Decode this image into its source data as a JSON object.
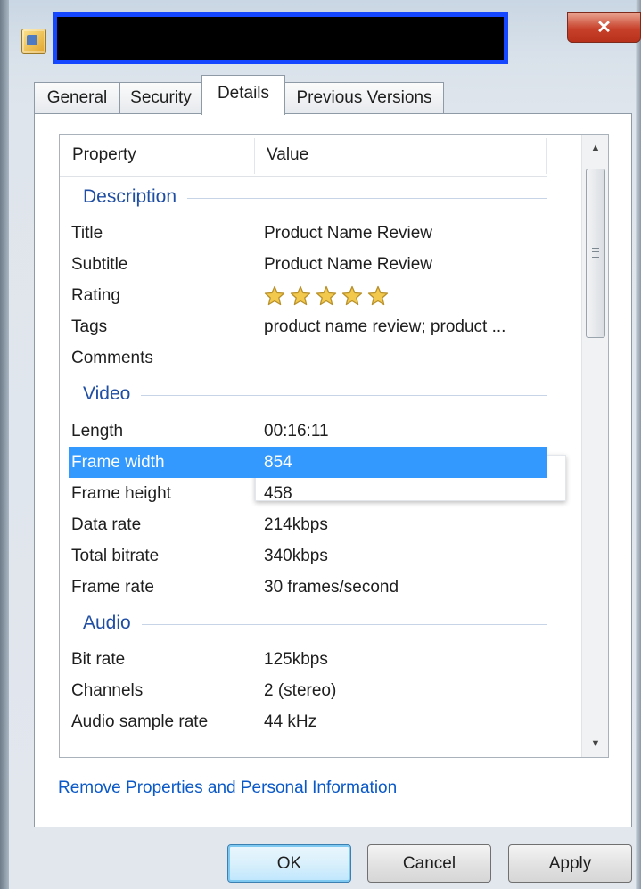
{
  "window": {
    "close_glyph": "✕",
    "title": ""
  },
  "tabs": [
    {
      "label": "General"
    },
    {
      "label": "Security"
    },
    {
      "label": "Details"
    },
    {
      "label": "Previous Versions"
    }
  ],
  "columns": {
    "property": "Property",
    "value": "Value"
  },
  "sections": {
    "description": "Description",
    "video": "Video",
    "audio": "Audio"
  },
  "rows": {
    "title": {
      "key": "Title",
      "value": "Product Name Review"
    },
    "subtitle": {
      "key": "Subtitle",
      "value": "Product Name Review"
    },
    "rating": {
      "key": "Rating",
      "stars": 5,
      "max_stars": 5
    },
    "tags": {
      "key": "Tags",
      "value": "product name review; product ..."
    },
    "comments": {
      "key": "Comments",
      "value": ""
    },
    "length": {
      "key": "Length",
      "value": "00:16:11"
    },
    "frame_width": {
      "key": "Frame width",
      "value": "854"
    },
    "frame_height": {
      "key": "Frame height",
      "value": "458"
    },
    "data_rate": {
      "key": "Data rate",
      "value": "214kbps"
    },
    "total_bitrate": {
      "key": "Total bitrate",
      "value": "340kbps"
    },
    "frame_rate": {
      "key": "Frame rate",
      "value": "30 frames/second"
    },
    "bit_rate": {
      "key": "Bit rate",
      "value": "125kbps"
    },
    "channels": {
      "key": "Channels",
      "value": "2 (stereo)"
    },
    "sample_rate": {
      "key": "Audio sample rate",
      "value": "44 kHz"
    }
  },
  "link": "Remove Properties and Personal Information",
  "buttons": {
    "ok": "OK",
    "cancel": "Cancel",
    "apply": "Apply"
  },
  "colors": {
    "selection": "#3399ff",
    "section_heading": "#1f4ea3",
    "star": "#f2c94c",
    "link": "#0b59c7"
  },
  "icons": {
    "app": "video-file-icon",
    "rating": "star-icon"
  }
}
